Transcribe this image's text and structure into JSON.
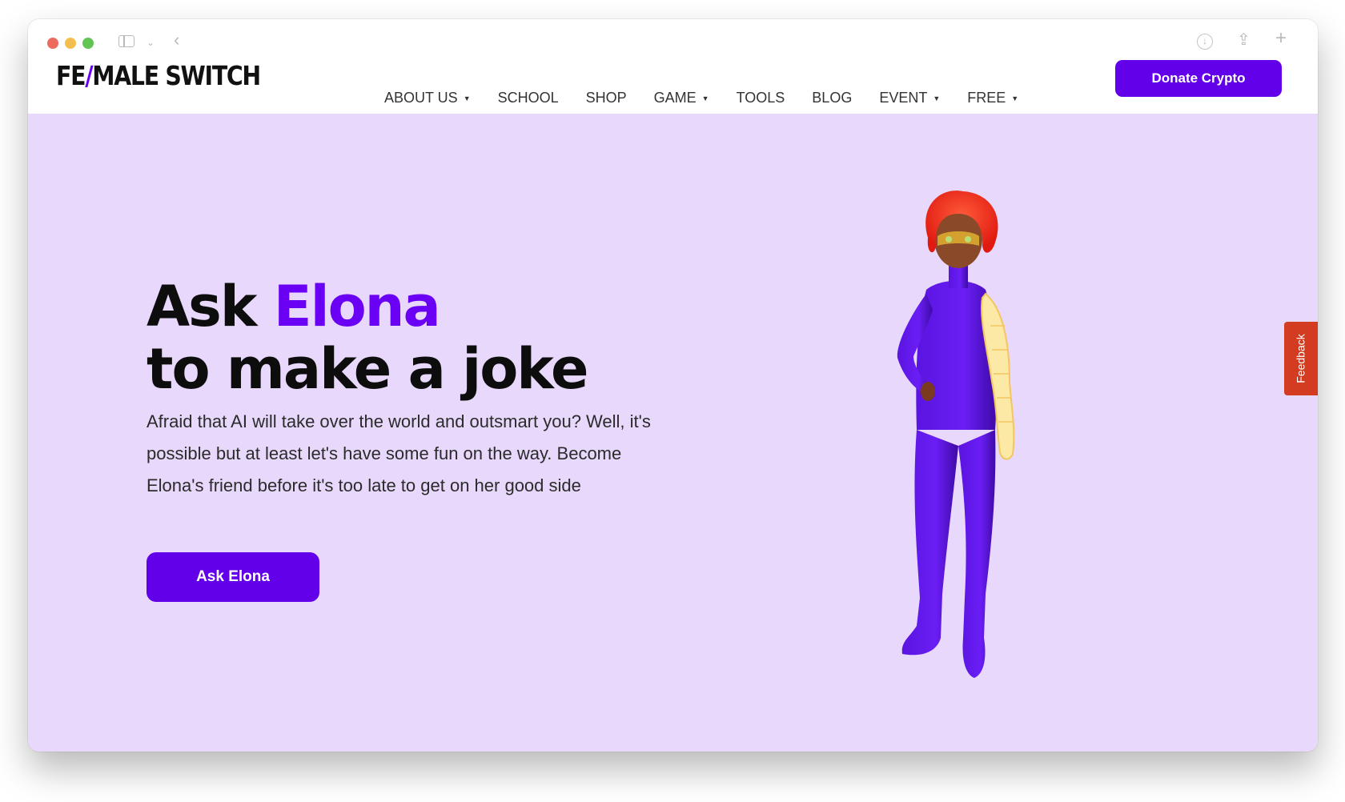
{
  "logo": {
    "part1": "FE",
    "slash": "/",
    "part2": "MALE SWITCH"
  },
  "nav": [
    {
      "label": "ABOUT US",
      "dropdown": true
    },
    {
      "label": "SCHOOL",
      "dropdown": false
    },
    {
      "label": "SHOP",
      "dropdown": false
    },
    {
      "label": "GAME",
      "dropdown": true
    },
    {
      "label": "TOOLS",
      "dropdown": false
    },
    {
      "label": "BLOG",
      "dropdown": false
    },
    {
      "label": "EVENT",
      "dropdown": true
    },
    {
      "label": "FREE",
      "dropdown": true
    }
  ],
  "header": {
    "donate_label": "Donate Crypto"
  },
  "hero": {
    "headline_part1": "Ask ",
    "headline_accent": "Elona",
    "headline_line2": "to make a joke",
    "description": "Afraid that AI will take over the world and outsmart you? Well, it's possible but at least let's have some fun on the way. Become Elona's friend before it's too late to get on her good side",
    "cta_label": "Ask Elona"
  },
  "feedback_label": "Feedback",
  "colors": {
    "accent": "#6200ea",
    "hero_background": "#e8d8fb",
    "feedback_tab": "#d43c22"
  },
  "icons": {
    "chrome": [
      "sidebar-icon",
      "chevron-down-icon",
      "back-arrow-icon",
      "download-icon",
      "share-icon",
      "plus-icon"
    ],
    "caret": "caret-down-icon"
  }
}
